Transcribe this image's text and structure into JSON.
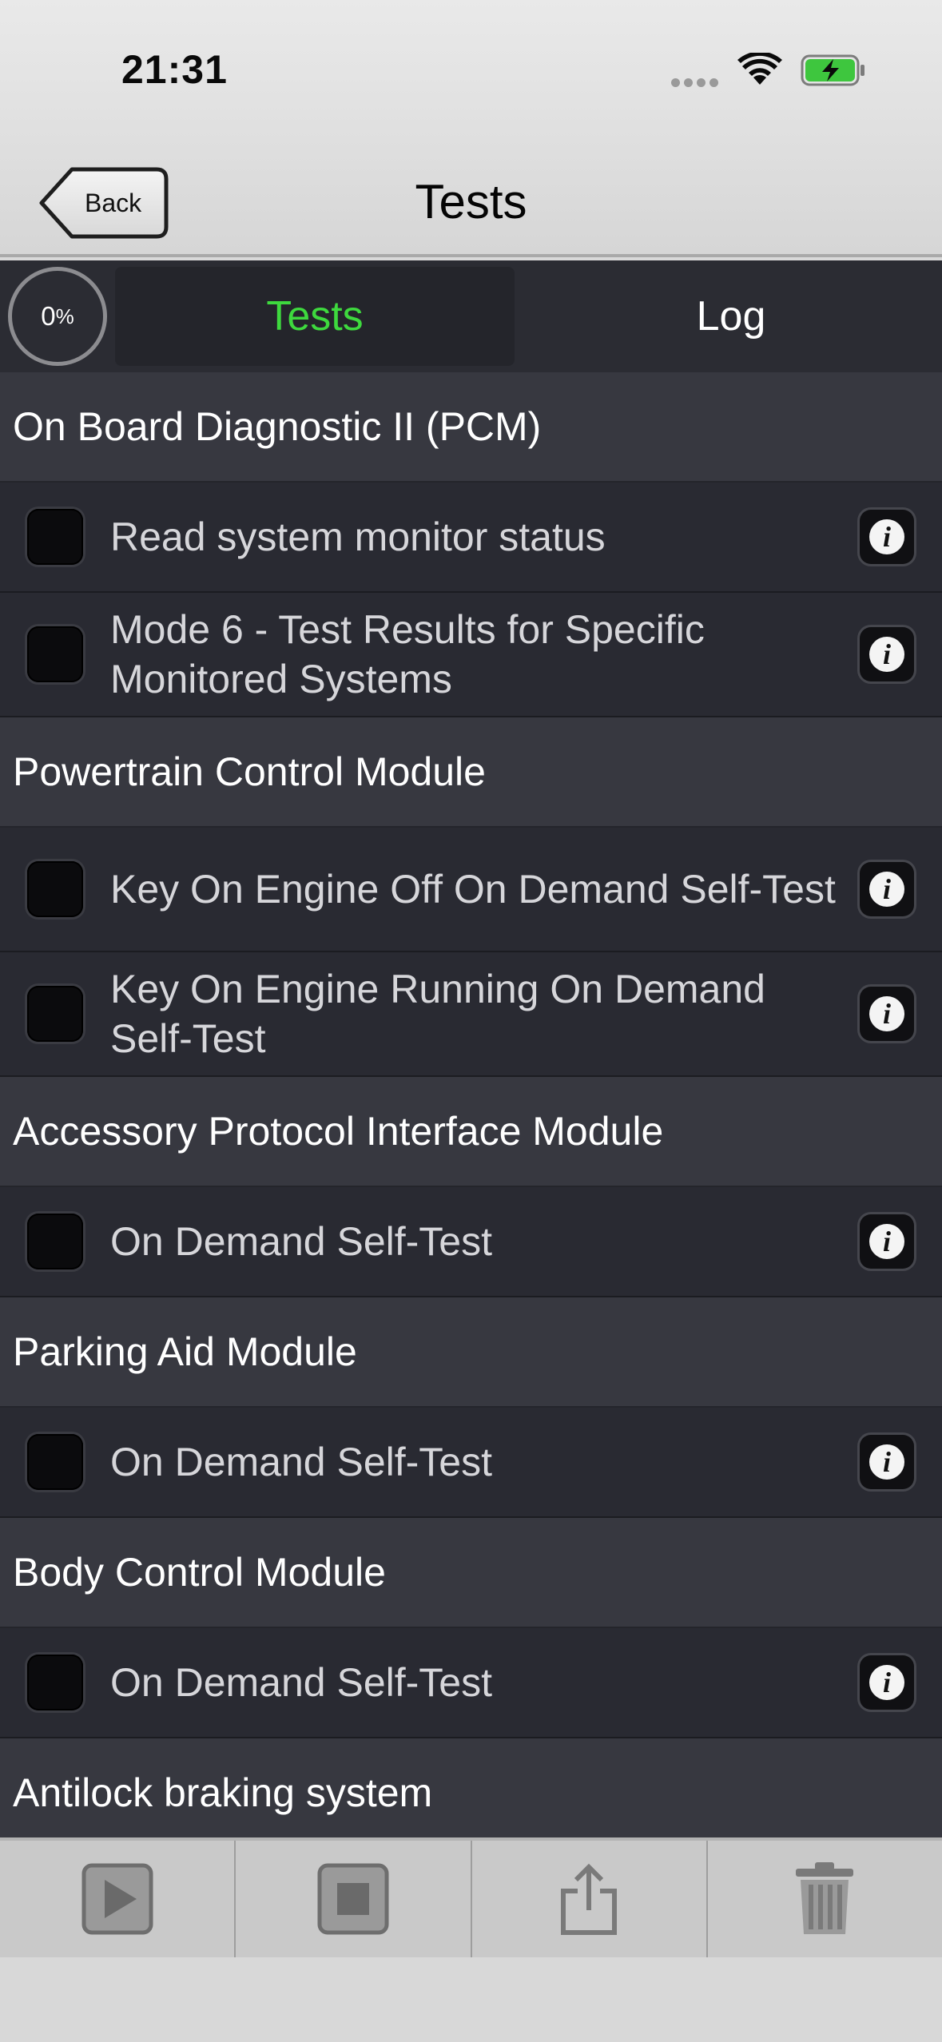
{
  "status_bar": {
    "time": "21:31"
  },
  "nav": {
    "back_label": "Back",
    "title": "Tests"
  },
  "segment": {
    "progress_value": "0",
    "progress_unit": "%",
    "tabs": [
      {
        "label": "Tests",
        "active": true
      },
      {
        "label": "Log",
        "active": false
      }
    ]
  },
  "sections": [
    {
      "title": "On Board Diagnostic II (PCM)",
      "items": [
        {
          "label": "Read system monitor status"
        },
        {
          "label": "Mode 6 - Test Results for Specific Monitored Systems"
        }
      ]
    },
    {
      "title": "Powertrain Control Module",
      "items": [
        {
          "label": "Key On Engine Off On Demand Self-Test"
        },
        {
          "label": "Key On Engine Running On Demand Self-Test"
        }
      ]
    },
    {
      "title": "Accessory Protocol Interface Module",
      "items": [
        {
          "label": "On Demand Self-Test"
        }
      ]
    },
    {
      "title": "Parking Aid Module",
      "items": [
        {
          "label": "On Demand Self-Test"
        }
      ]
    },
    {
      "title": "Body Control Module",
      "items": [
        {
          "label": "On Demand Self-Test"
        }
      ]
    },
    {
      "title": "Antilock braking system",
      "items": []
    }
  ],
  "toolbar": {
    "play_icon": "play-icon",
    "stop_icon": "stop-icon",
    "share_icon": "share-icon",
    "trash_icon": "trash-icon"
  },
  "colors": {
    "active_tab": "#3ed93e",
    "list_bg": "#2e2f37"
  }
}
